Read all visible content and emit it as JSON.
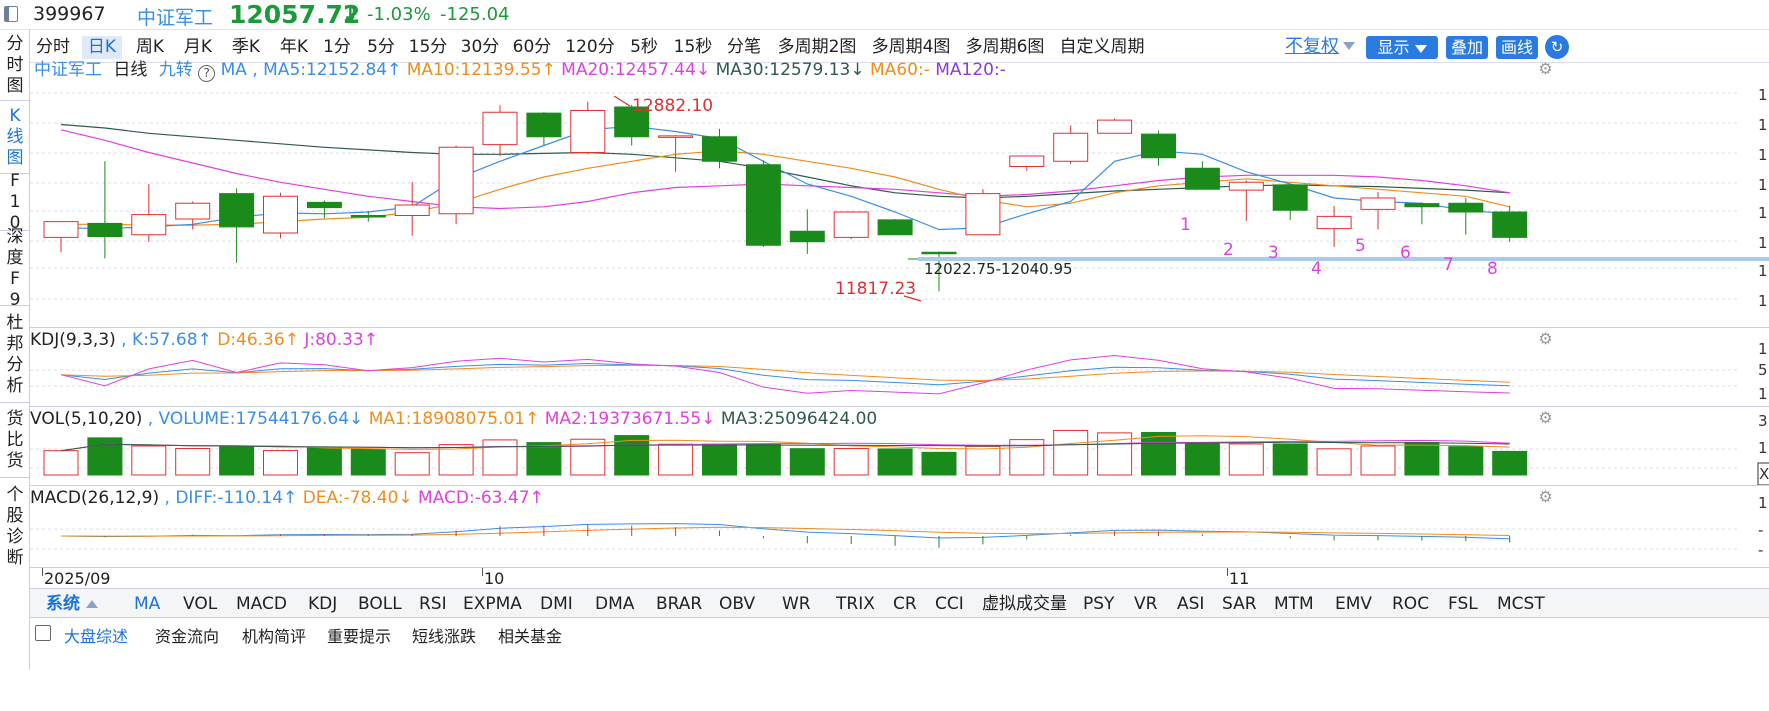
{
  "header": {
    "code": "399967",
    "name": "中证军工",
    "price": "12057.72",
    "arrow": "↓",
    "change_pct": "-1.03%",
    "change": "-125.04"
  },
  "sidebar": [
    {
      "label": "分时图",
      "active": false
    },
    {
      "label": "K线图",
      "active": true
    },
    {
      "label": "F10",
      "active": false
    },
    {
      "label": "深度F9",
      "active": false
    },
    {
      "label": "杜邦分析",
      "active": false
    },
    {
      "label": "货比货",
      "active": false
    },
    {
      "label": "个股诊断",
      "active": false
    }
  ],
  "period_tabs": [
    "分时",
    "日K",
    "周K",
    "月K",
    "季K",
    "年K",
    "1分",
    "5分",
    "15分",
    "30分",
    "60分",
    "120分",
    "5秒",
    "15秒",
    "分笔",
    "多周期2图",
    "多周期4图",
    "多周期6图",
    "自定义周期"
  ],
  "period_active": "日K",
  "toolbar": {
    "restore": "不复权",
    "display": "显示",
    "overlay": "叠加",
    "draw": "画线"
  },
  "main_legend": {
    "name": "中证军工",
    "period": "日线",
    "nine": "九转",
    "ma_label": "MA ,",
    "ma5": "MA5:12152.84↑",
    "ma10": "MA10:12139.55↑",
    "ma20": "MA20:12457.44↓",
    "ma30": "MA30:12579.13↓",
    "ma60": "MA60:-",
    "ma120": "MA120:-"
  },
  "annotations": {
    "high": "12882.10",
    "low": "11817.23",
    "range": "12022.75-12040.95",
    "nine_numbers": [
      "1",
      "2",
      "3",
      "4",
      "5",
      "6",
      "7",
      "8"
    ]
  },
  "kdj_legend": {
    "name": "KDJ(9,3,3)",
    "k": ", K:57.68↑",
    "d": "D:46.36↑",
    "j": "J:80.33↑"
  },
  "vol_legend": {
    "name": "VOL(5,10,20)",
    "volume": ", VOLUME:17544176.64↓",
    "ma1": "MA1:18908075.01↑",
    "ma2": "MA2:19373671.55↓",
    "ma3": "MA3:25096424.00"
  },
  "macd_legend": {
    "name": "MACD(26,12,9)",
    "diff": ", DIFF:-110.14↑",
    "dea": "DEA:-78.40↓",
    "macd": "MACD:-63.47↑"
  },
  "date_axis": [
    "2025/09",
    "10",
    "11"
  ],
  "indicator_tabs": [
    "系统",
    "MA",
    "VOL",
    "MACD",
    "KDJ",
    "BOLL",
    "RSI",
    "EXPMA",
    "DMI",
    "DMA",
    "BRAR",
    "OBV",
    "WR",
    "TRIX",
    "CR",
    "CCI",
    "虚拟成交量",
    "PSY",
    "VR",
    "ASI",
    "SAR",
    "MTM",
    "EMV",
    "ROC",
    "FSL",
    "MCST"
  ],
  "indicator_active": "MA",
  "footer_tabs": [
    "大盘综述",
    "资金流向",
    "机构简评",
    "重要提示",
    "短线涨跌",
    "相关基金"
  ],
  "colors": {
    "up": "#e03030",
    "down": "#1a8a1a",
    "price": "#1a9a3a",
    "ma5": "#3a8ee6",
    "ma10": "#f08c1c",
    "ma20": "#e040e0",
    "ma30": "#2f5a4a",
    "accent": "#1a73d9"
  },
  "chart_data": {
    "type": "candlestick",
    "candles": [
      {
        "o": 12125,
        "h": 12180,
        "l": 12040,
        "c": 12215
      },
      {
        "o": 12205,
        "h": 12560,
        "l": 12005,
        "c": 12130
      },
      {
        "o": 12140,
        "h": 12430,
        "l": 12100,
        "c": 12255
      },
      {
        "o": 12230,
        "h": 12330,
        "l": 12170,
        "c": 12320
      },
      {
        "o": 12375,
        "h": 12405,
        "l": 11980,
        "c": 12185
      },
      {
        "o": 12150,
        "h": 12380,
        "l": 12120,
        "c": 12360
      },
      {
        "o": 12325,
        "h": 12335,
        "l": 12235,
        "c": 12295
      },
      {
        "o": 12250,
        "h": 12275,
        "l": 12215,
        "c": 12245
      },
      {
        "o": 12250,
        "h": 12440,
        "l": 12135,
        "c": 12310
      },
      {
        "o": 12260,
        "h": 12650,
        "l": 12200,
        "c": 12640
      },
      {
        "o": 12655,
        "h": 12880,
        "l": 12590,
        "c": 12840
      },
      {
        "o": 12835,
        "h": 12840,
        "l": 12650,
        "c": 12700
      },
      {
        "o": 12610,
        "h": 12900,
        "l": 12600,
        "c": 12850
      },
      {
        "o": 12870,
        "h": 12882.1,
        "l": 12650,
        "c": 12700
      },
      {
        "o": 12705,
        "h": 12710,
        "l": 12500,
        "c": 12705
      },
      {
        "o": 12700,
        "h": 12745,
        "l": 12520,
        "c": 12560
      },
      {
        "o": 12540,
        "h": 12565,
        "l": 12070,
        "c": 12080
      },
      {
        "o": 12160,
        "h": 12285,
        "l": 12030,
        "c": 12100
      },
      {
        "o": 12125,
        "h": 12275,
        "l": 12115,
        "c": 12270
      },
      {
        "o": 12225,
        "h": 12230,
        "l": 12140,
        "c": 12140
      },
      {
        "o": 12040,
        "h": 12045,
        "l": 11817.23,
        "c": 12035
      },
      {
        "o": 12140,
        "h": 12400,
        "l": 12140,
        "c": 12375
      },
      {
        "o": 12530,
        "h": 12560,
        "l": 12505,
        "c": 12590
      },
      {
        "o": 12560,
        "h": 12765,
        "l": 12545,
        "c": 12720
      },
      {
        "o": 12720,
        "h": 12805,
        "l": 12725,
        "c": 12795
      },
      {
        "o": 12715,
        "h": 12735,
        "l": 12535,
        "c": 12580
      },
      {
        "o": 12520,
        "h": 12560,
        "l": 12400,
        "c": 12400
      },
      {
        "o": 12395,
        "h": 12450,
        "l": 12220,
        "c": 12440
      },
      {
        "o": 12425,
        "h": 12425,
        "l": 12225,
        "c": 12280
      },
      {
        "o": 12175,
        "h": 12305,
        "l": 12070,
        "c": 12245
      },
      {
        "o": 12285,
        "h": 12385,
        "l": 12170,
        "c": 12350
      },
      {
        "o": 12318,
        "h": 12325,
        "l": 12200,
        "c": 12300
      },
      {
        "o": 12320,
        "h": 12350,
        "l": 12140,
        "c": 12270
      },
      {
        "o": 12270,
        "h": 12305,
        "l": 12100,
        "c": 12125
      }
    ],
    "ma5": [
      12180,
      12175,
      12185,
      12200,
      12240,
      12265,
      12260,
      12270,
      12300,
      12460,
      12560,
      12650,
      12740,
      12760,
      12730,
      12690,
      12560,
      12430,
      12360,
      12270,
      12170,
      12180,
      12260,
      12330,
      12560,
      12620,
      12600,
      12500,
      12430,
      12350,
      12330,
      12320,
      12280,
      12260
    ],
    "ma10": [
      12200,
      12200,
      12195,
      12195,
      12200,
      12215,
      12230,
      12240,
      12270,
      12320,
      12400,
      12470,
      12520,
      12560,
      12600,
      12620,
      12600,
      12560,
      12520,
      12470,
      12400,
      12340,
      12300,
      12320,
      12380,
      12420,
      12440,
      12460,
      12440,
      12420,
      12400,
      12380,
      12360,
      12300
    ],
    "ma20": [
      12740,
      12680,
      12610,
      12550,
      12490,
      12440,
      12400,
      12360,
      12330,
      12300,
      12290,
      12300,
      12330,
      12380,
      12410,
      12420,
      12430,
      12420,
      12410,
      12400,
      12380,
      12360,
      12370,
      12390,
      12420,
      12450,
      12470,
      12480,
      12480,
      12480,
      12470,
      12450,
      12420,
      12380
    ],
    "ma30": [
      12770,
      12750,
      12720,
      12700,
      12680,
      12660,
      12640,
      12625,
      12610,
      12600,
      12600,
      12605,
      12610,
      12600,
      12580,
      12560,
      12520,
      12470,
      12420,
      12380,
      12360,
      12350,
      12360,
      12375,
      12390,
      12400,
      12410,
      12420,
      12425,
      12420,
      12415,
      12405,
      12395,
      12380
    ],
    "support_level": 12040.95,
    "range_label": "12022.75-12040.95",
    "y_range": [
      11750,
      12950
    ],
    "volume": [
      18.0,
      27.5,
      21.5,
      19.6,
      21.0,
      18.1,
      20.0,
      19.2,
      16.5,
      22.5,
      26.0,
      24.0,
      26.5,
      29.2,
      22.8,
      22.8,
      23.0,
      19.5,
      19.6,
      19.3,
      16.8,
      21.2,
      26.2,
      33.0,
      31.2,
      31.5,
      23.5,
      23.0,
      23.0,
      19.4,
      21.5,
      24.0,
      21.0,
      17.5
    ]
  }
}
